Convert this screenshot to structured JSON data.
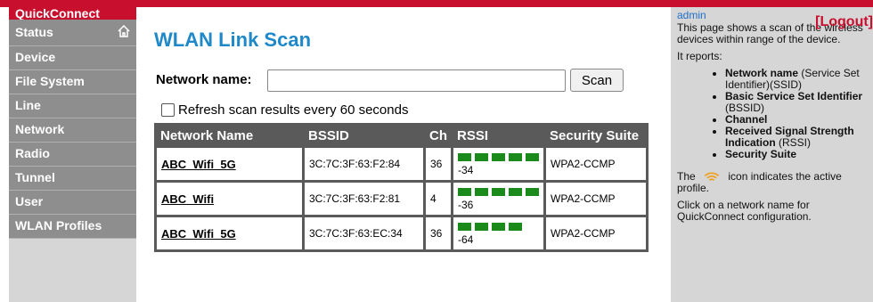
{
  "sidebar": {
    "items": [
      {
        "label": "QuickConnect"
      },
      {
        "label": "Status"
      },
      {
        "label": "Device"
      },
      {
        "label": "File System"
      },
      {
        "label": "Line"
      },
      {
        "label": "Network"
      },
      {
        "label": "Radio"
      },
      {
        "label": "Tunnel"
      },
      {
        "label": "User"
      },
      {
        "label": "WLAN Profiles"
      }
    ]
  },
  "main": {
    "title": "WLAN Link Scan",
    "network_name_label": "Network name:",
    "network_name_value": "",
    "scan_button": "Scan",
    "refresh_label": "Refresh scan results every 60 seconds",
    "refresh_checked": false,
    "table": {
      "headers": [
        "Network Name",
        "BSSID",
        "Ch",
        "RSSI",
        "Security Suite"
      ],
      "rows": [
        {
          "name": "ABC_Wifi_5G",
          "bssid": "3C:7C:3F:63:F2:84",
          "ch": "36",
          "rssi": "-34",
          "bars": 5,
          "security": "WPA2-CCMP"
        },
        {
          "name": "ABC_Wifi",
          "bssid": "3C:7C:3F:63:F2:81",
          "ch": "4",
          "rssi": "-36",
          "bars": 5,
          "security": "WPA2-CCMP"
        },
        {
          "name": "ABC_Wifi_5G",
          "bssid": "3C:7C:3F:63:EC:34",
          "ch": "36",
          "rssi": "-64",
          "bars": 4,
          "security": "WPA2-CCMP"
        }
      ]
    }
  },
  "help": {
    "user": "admin",
    "logout": "[Logout]",
    "intro": "This page shows a scan of the wireless devices within range of the device.",
    "reports": "It reports:",
    "list": [
      {
        "bold": "Network name",
        "light": " (Service Set Identifier)(SSID)"
      },
      {
        "bold": "Basic Service Set Identifier",
        "light": " (BSSID)"
      },
      {
        "bold": "Channel",
        "light": ""
      },
      {
        "bold": "Received Signal Strength Indication",
        "light": " (RSSI)"
      },
      {
        "bold": "Security Suite",
        "light": ""
      }
    ],
    "icon_note_prefix": "The",
    "icon_note_suffix": "icon indicates the active profile.",
    "click_note": "Click on a network name for QuickConnect configuration."
  },
  "colors": {
    "brand_red": "#c8102e",
    "title_blue": "#1e88c8",
    "signal_green": "#1a8a1a",
    "wifi_orange": "#f0a020"
  }
}
